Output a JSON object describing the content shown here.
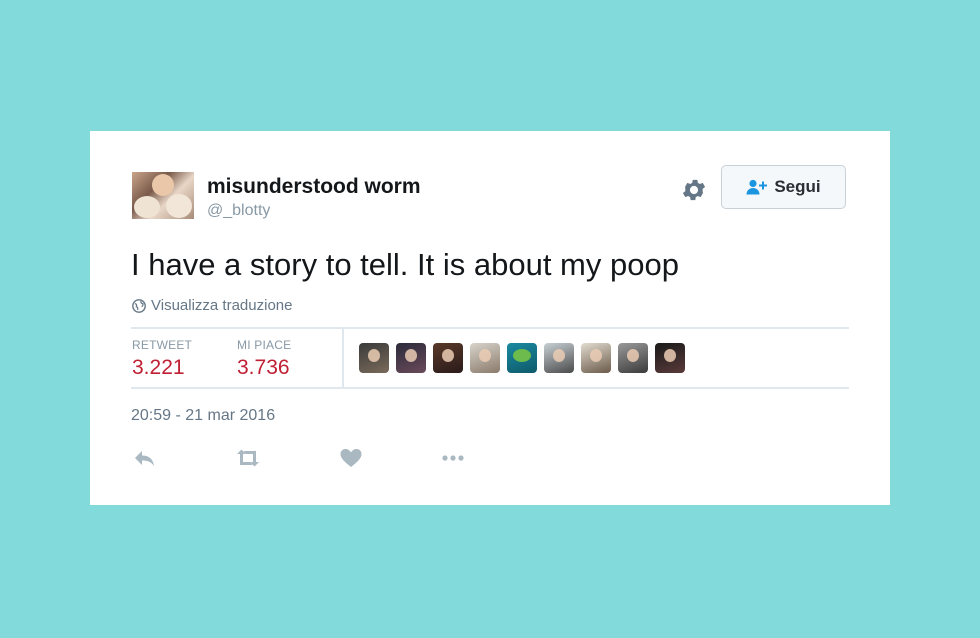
{
  "tweet": {
    "display_name": "misunderstood worm",
    "handle": "@_blotty",
    "text": "I have a story to tell. It is about my poop",
    "translate_label": "Visualizza traduzione",
    "timestamp": "20:59 - 21 mar 2016"
  },
  "follow_button": {
    "label": "Segui",
    "icon": "add-user-icon"
  },
  "stats": {
    "retweets": {
      "label": "RETWEET",
      "value": "3.221"
    },
    "likes": {
      "label": "MI PIACE",
      "value": "3.736"
    }
  },
  "likers": [
    {
      "icon": "liker-avatar"
    },
    {
      "icon": "liker-avatar"
    },
    {
      "icon": "liker-avatar"
    },
    {
      "icon": "liker-avatar"
    },
    {
      "icon": "liker-avatar"
    },
    {
      "icon": "liker-avatar"
    },
    {
      "icon": "liker-avatar"
    },
    {
      "icon": "liker-avatar"
    },
    {
      "icon": "liker-avatar"
    }
  ],
  "actions": [
    "reply-icon",
    "retweet-icon",
    "like-icon",
    "more-icon"
  ],
  "colors": {
    "background": "#83dada",
    "card": "#ffffff",
    "stat_value": "#c01f34",
    "muted_text": "#8899a6",
    "follow_icon": "#1b95e0"
  }
}
